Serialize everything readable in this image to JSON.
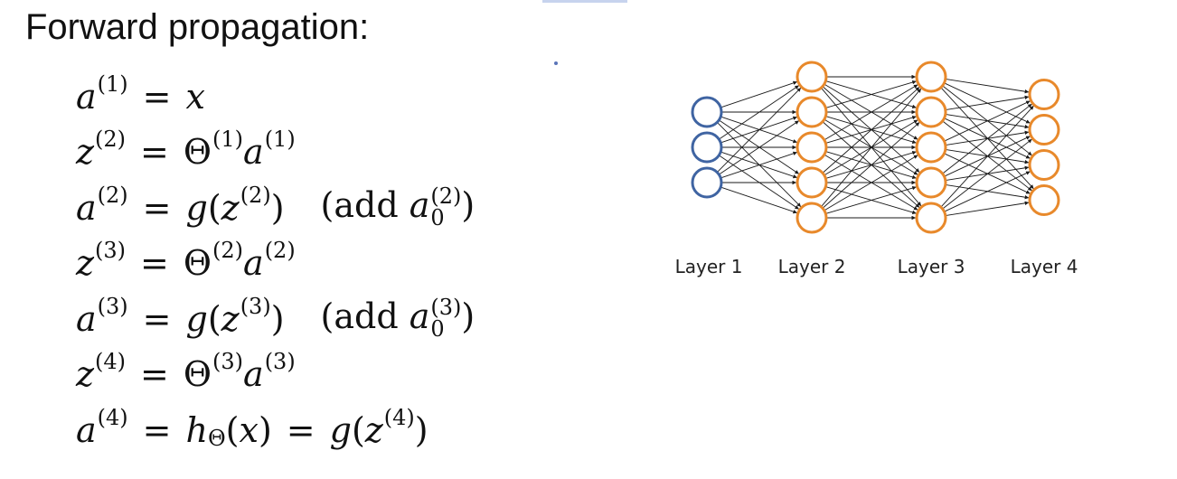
{
  "slide": {
    "title": "Forward propagation:"
  },
  "equations": [
    {
      "lhs": "a",
      "lhs_sup": "(1)",
      "rhs": [
        {
          "t": "x",
          "i": true
        }
      ]
    },
    {
      "lhs": "z",
      "lhs_sup": "(2)",
      "rhs": [
        {
          "t": "Θ",
          "i": false
        },
        {
          "t": "(1)",
          "sup": true
        },
        {
          "t": "a",
          "i": true
        },
        {
          "t": "(1)",
          "sup": true
        }
      ]
    },
    {
      "lhs": "a",
      "lhs_sup": "(2)",
      "rhs": [
        {
          "t": "g",
          "i": true
        },
        {
          "t": "(",
          "i": false
        },
        {
          "t": "z",
          "i": true
        },
        {
          "t": "(2)",
          "sup": true
        },
        {
          "t": ")",
          "i": false
        }
      ],
      "note": {
        "text": "(add ",
        "var": "a",
        "sup": "(2)",
        "sub": "0",
        "close": ")"
      }
    },
    {
      "lhs": "z",
      "lhs_sup": "(3)",
      "rhs": [
        {
          "t": "Θ",
          "i": false
        },
        {
          "t": "(2)",
          "sup": true
        },
        {
          "t": "a",
          "i": true
        },
        {
          "t": "(2)",
          "sup": true
        }
      ]
    },
    {
      "lhs": "a",
      "lhs_sup": "(3)",
      "rhs": [
        {
          "t": "g",
          "i": true
        },
        {
          "t": "(",
          "i": false
        },
        {
          "t": "z",
          "i": true
        },
        {
          "t": "(3)",
          "sup": true
        },
        {
          "t": ")",
          "i": false
        }
      ],
      "note": {
        "text": "(add ",
        "var": "a",
        "sup": "(3)",
        "sub": "0",
        "close": ")"
      }
    },
    {
      "lhs": "z",
      "lhs_sup": "(4)",
      "rhs": [
        {
          "t": "Θ",
          "i": false
        },
        {
          "t": "(3)",
          "sup": true
        },
        {
          "t": "a",
          "i": true
        },
        {
          "t": "(3)",
          "sup": true
        }
      ]
    },
    {
      "lhs": "a",
      "lhs_sup": "(4)",
      "rhs": [
        {
          "t": "h",
          "i": true
        },
        {
          "t": "Θ",
          "sub": true
        },
        {
          "t": "(",
          "i": false
        },
        {
          "t": "x",
          "i": true
        },
        {
          "t": ")",
          "i": false
        },
        {
          "t": " = ",
          "eq": true
        },
        {
          "t": "g",
          "i": true
        },
        {
          "t": "(",
          "i": false
        },
        {
          "t": "z",
          "i": true
        },
        {
          "t": "(4)",
          "sup": true
        },
        {
          "t": ")",
          "i": false
        }
      ]
    }
  ],
  "network": {
    "layers": [
      {
        "label": "Layer 1",
        "units": 3,
        "color": "#3f64a2"
      },
      {
        "label": "Layer 2",
        "units": 5,
        "color": "#e8892b"
      },
      {
        "label": "Layer 3",
        "units": 5,
        "color": "#e8892b"
      },
      {
        "label": "Layer 4",
        "units": 4,
        "color": "#e8892b"
      }
    ],
    "edge_color": "#1a1a1a"
  }
}
